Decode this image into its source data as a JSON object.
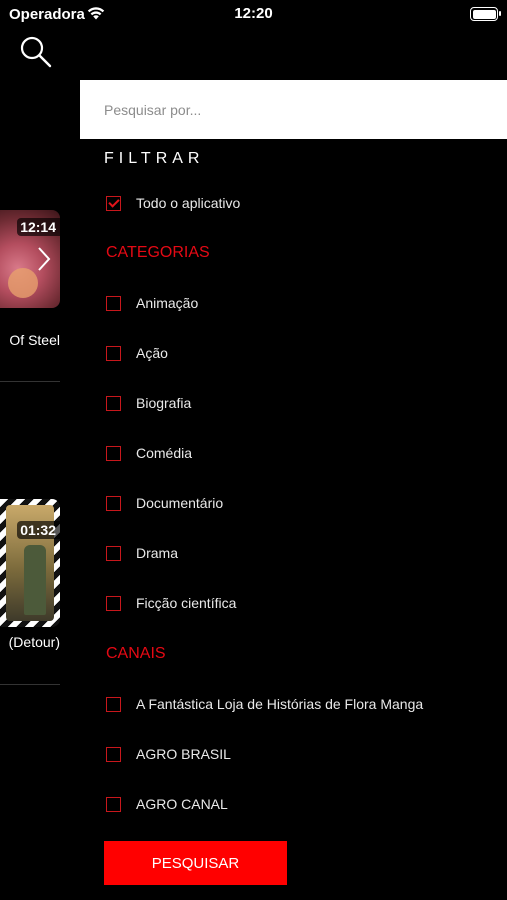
{
  "status_bar": {
    "carrier": "Operadora",
    "time": "12:20"
  },
  "background": {
    "items": [
      {
        "duration": "12:14",
        "title": "Of Steel"
      },
      {
        "duration": "01:32",
        "title": "(Detour)"
      }
    ]
  },
  "drawer": {
    "search": {
      "placeholder": "Pesquisar por..."
    },
    "filter_title": "FILTRAR",
    "all_app": {
      "label": "Todo o aplicativo",
      "checked": true
    },
    "categories_title": "CATEGORIAS",
    "categories": [
      "Animação",
      "Ação",
      "Biografia",
      "Comédia",
      "Documentário",
      "Drama",
      "Ficção científica"
    ],
    "channels_title": "CANAIS",
    "channels": [
      "A Fantástica Loja de Histórias de Flora Manga",
      "AGRO BRASIL",
      "AGRO CANAL"
    ],
    "submit_label": "PESQUISAR"
  },
  "colors": {
    "accent": "#e50914",
    "button": "#ff0000",
    "background": "#000000"
  }
}
